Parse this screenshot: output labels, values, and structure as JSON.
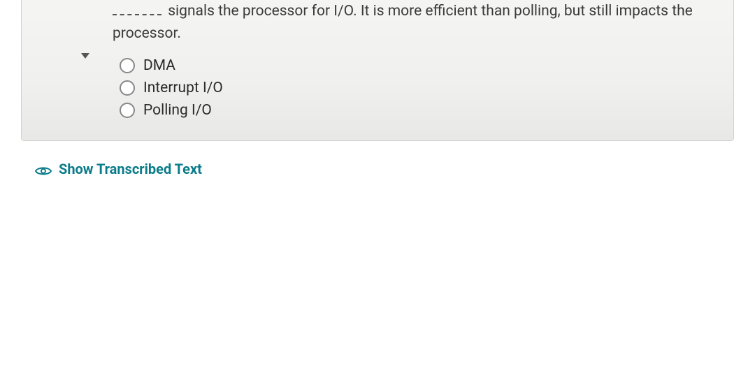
{
  "question": {
    "text_after_blank": " signals the processor for I/O.  It is more efficient than polling, but still impacts the processor.",
    "options": [
      {
        "label": "DMA"
      },
      {
        "label": "Interrupt I/O"
      },
      {
        "label": "Polling I/O"
      }
    ]
  },
  "controls": {
    "show_transcribed_label": "Show Transcribed Text"
  }
}
